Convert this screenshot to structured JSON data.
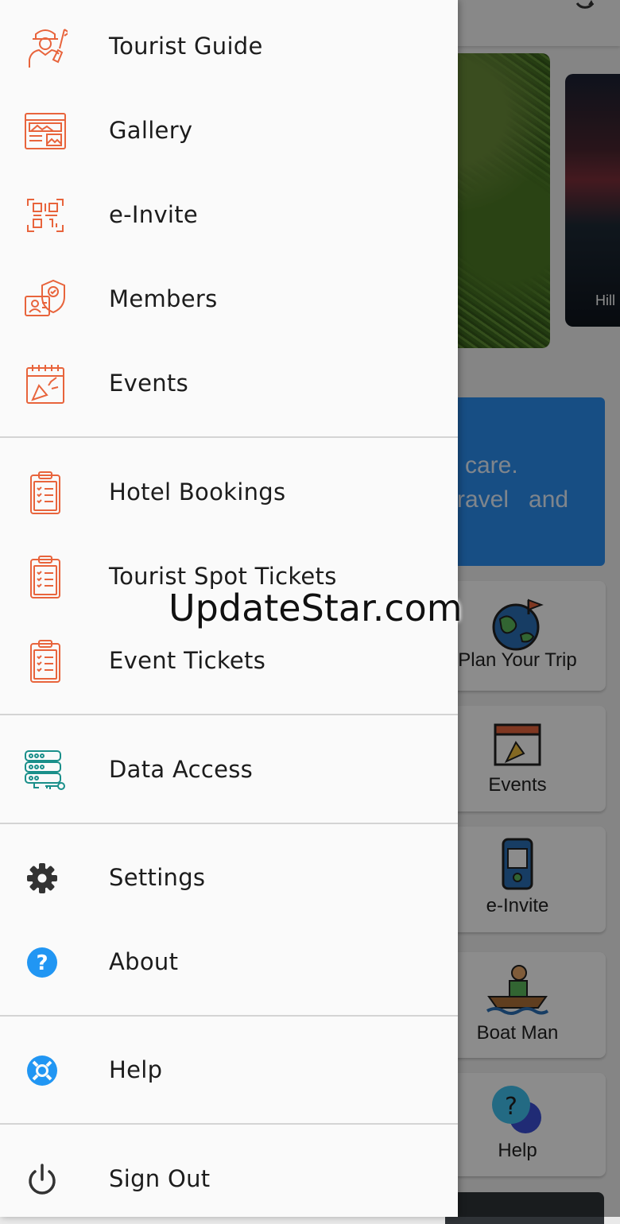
{
  "background": {
    "photo_caption": "Hill",
    "banner_line1": "care.",
    "banner_line2": "ravel   and",
    "tiles": [
      "Plan Your Trip",
      "Events",
      "e-Invite",
      "Boat Man",
      "Help"
    ]
  },
  "drawer": {
    "items": [
      {
        "label": "Tourist Guide",
        "icon": "tourist-guide-icon"
      },
      {
        "label": "Gallery",
        "icon": "gallery-icon"
      },
      {
        "label": "e-Invite",
        "icon": "qr-code-icon"
      },
      {
        "label": "Members",
        "icon": "members-shield-icon"
      },
      {
        "label": "Events",
        "icon": "events-calendar-icon"
      },
      {
        "label": "Hotel Bookings",
        "icon": "clipboard-icon"
      },
      {
        "label": "Tourist Spot Tickets",
        "icon": "clipboard-icon"
      },
      {
        "label": "Event Tickets",
        "icon": "clipboard-icon"
      },
      {
        "label": "Data Access",
        "icon": "database-key-icon"
      },
      {
        "label": "Settings",
        "icon": "gear-icon"
      },
      {
        "label": "About",
        "icon": "question-icon"
      },
      {
        "label": "Help",
        "icon": "lifebuoy-icon"
      },
      {
        "label": "Sign Out",
        "icon": "power-icon"
      }
    ]
  },
  "watermark": "UpdateStar.com",
  "colors": {
    "icon_orange": "#e8643c",
    "icon_teal": "#1a8f8a",
    "icon_blue": "#2196f3",
    "icon_dark": "#333333",
    "banner_blue": "#2b8ff0"
  }
}
